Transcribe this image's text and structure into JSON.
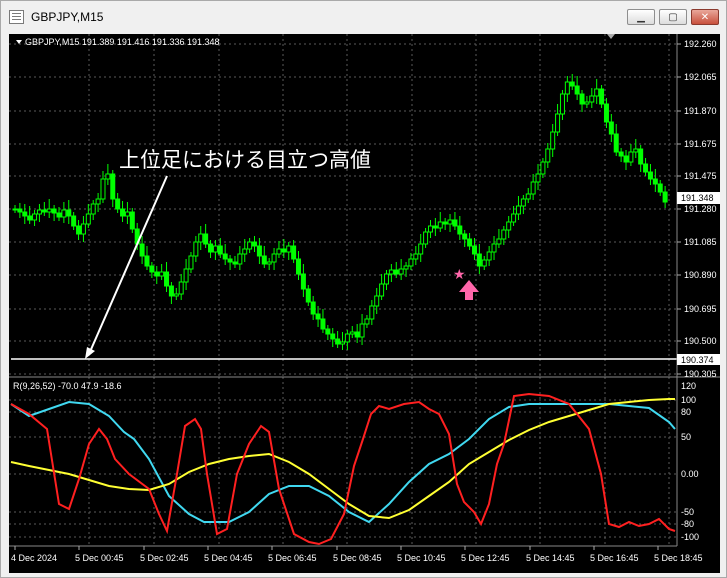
{
  "window": {
    "title": "GBPJPY,M15",
    "minimize_icon": "minimize-icon",
    "restore_icon": "restore-icon",
    "close_icon": "close-icon"
  },
  "chart_info": "GBPJPY,M15  191.389 191.416 191.336 191.348",
  "annotation": "上位足における目立つ高値",
  "price_axis": {
    "ticks": [
      "192.260",
      "192.065",
      "191.870",
      "191.675",
      "191.475",
      "191.280",
      "191.085",
      "190.890",
      "190.695",
      "190.500",
      "190.305"
    ],
    "current_price": "191.348",
    "line_price": "190.374"
  },
  "indicator": {
    "label": "R(9,26,52) -70.0 47.9 -18.6",
    "ticks": [
      "120",
      "100",
      "80",
      "50",
      "0.00",
      "-50",
      "-80",
      "-100"
    ],
    "colors": {
      "red": "#ff2020",
      "cyan": "#40d8f0",
      "yellow": "#ffff33"
    }
  },
  "time_axis": [
    "4 Dec 2024",
    "5 Dec 00:45",
    "5 Dec 02:45",
    "5 Dec 04:45",
    "5 Dec 06:45",
    "5 Dec 08:45",
    "5 Dec 10:45",
    "5 Dec 12:45",
    "5 Dec 14:45",
    "5 Dec 16:45",
    "5 Dec 18:45"
  ],
  "colors": {
    "background": "#000000",
    "candle": "#00ff00",
    "grid": "#5a5a5a",
    "text": "#ffffff",
    "marker": "#ff66aa"
  }
}
